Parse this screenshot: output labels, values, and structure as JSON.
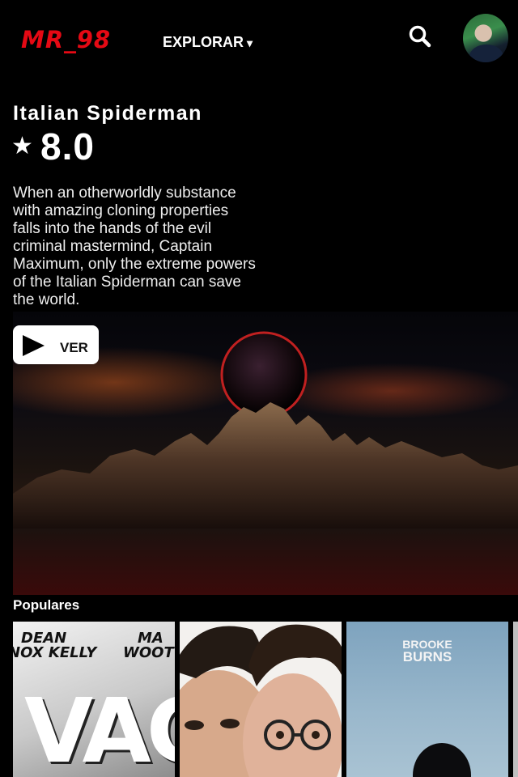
{
  "header": {
    "logo": "MR_98",
    "explore_label": "EXPLORAR",
    "explore_caret": "▾",
    "search_icon": "search-icon",
    "avatar_icon": "user-avatar"
  },
  "featured": {
    "title": "Italian Spiderman",
    "star": "★",
    "rating": "8.0",
    "description": "When an otherworldly substance with amazing cloning properties falls into the hands of the evil criminal mastermind, Captain Maximum, only the extreme powers of the Italian Spiderman can save the world.",
    "play_label": "VER",
    "play_icon": "play-icon"
  },
  "popular": {
    "heading": "Populares",
    "posters": [
      {
        "line1_left": "DEAN",
        "line2_left": "NOX KELLY",
        "line1_right": "MA",
        "line2_right": "WOOT",
        "big": "VAC"
      },
      {
        "icon": "poster-two-men"
      },
      {
        "line1": "BROOKE",
        "line2": "BURNS"
      },
      {
        "icon": "poster-partial"
      }
    ]
  },
  "colors": {
    "brand": "#e50914",
    "background": "#000000",
    "button_bg": "#ffffff"
  }
}
